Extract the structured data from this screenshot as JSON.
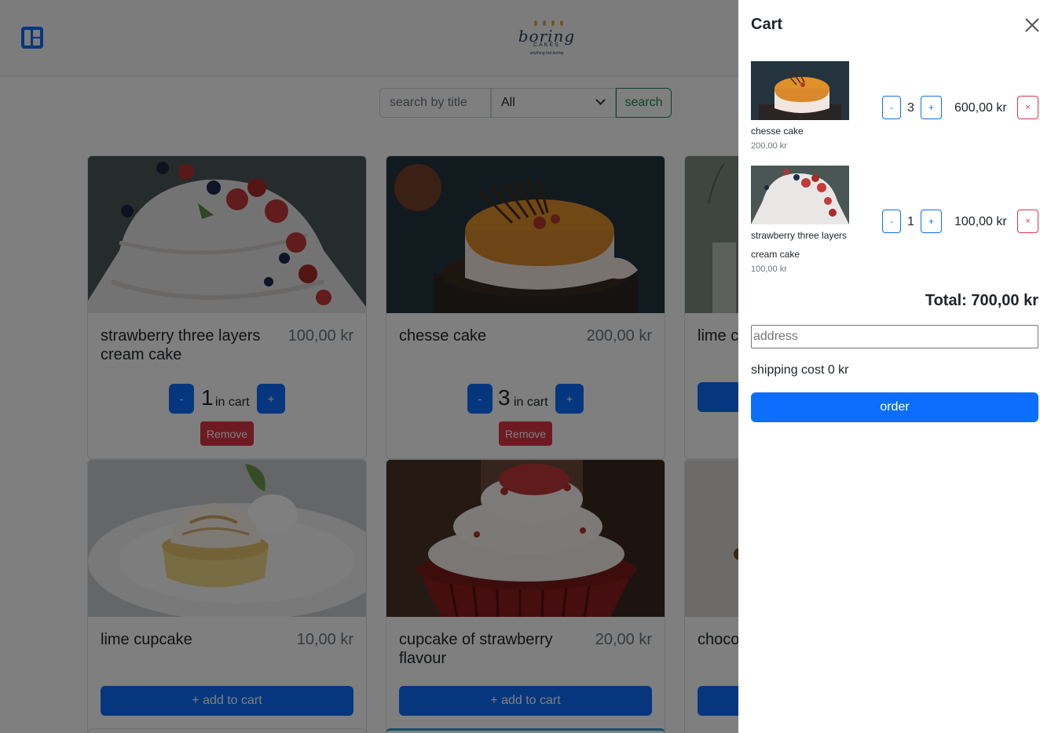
{
  "header": {
    "logo_text": "boring",
    "logo_sub": "CAKES",
    "logo_tagline": "anything but boring"
  },
  "search": {
    "placeholder": "search by title",
    "category_selected": "All",
    "button_label": "search"
  },
  "products": [
    {
      "title": "strawberry three layers cream cake",
      "price": "100,00 kr",
      "quantity": "1",
      "in_cart_label": "in cart",
      "minus_label": "-",
      "plus_label": "+",
      "remove_label": "Remove"
    },
    {
      "title": "chesse cake",
      "price": "200,00 kr",
      "quantity": "3",
      "in_cart_label": "in cart",
      "minus_label": "-",
      "plus_label": "+",
      "remove_label": "Remove"
    },
    {
      "title": "lime c"
    },
    {
      "title": "lime cupcake",
      "price": "10,00 kr",
      "add_label": "+ add to cart"
    },
    {
      "title": "cupcake of strawberry flavour",
      "price": "20,00 kr",
      "add_label": "+ add to cart"
    },
    {
      "title": "choco mint c"
    }
  ],
  "cart": {
    "title": "Cart",
    "items": [
      {
        "name": "chesse cake",
        "unit_price": "200,00 kr",
        "quantity": "3",
        "total": "600,00 kr",
        "minus_label": "-",
        "plus_label": "+",
        "remove_label": "×"
      },
      {
        "name": "strawberry three layers cream cake",
        "unit_price": "100,00 kr",
        "quantity": "1",
        "total": "100,00 kr",
        "minus_label": "-",
        "plus_label": "+",
        "remove_label": "×"
      }
    ],
    "total_label": "Total: 700,00 kr",
    "address_placeholder": "address",
    "shipping_label": "shipping cost 0 kr",
    "order_label": "order"
  },
  "colors": {
    "primary": "#0d6efd",
    "danger": "#dc3545",
    "success": "#198754"
  }
}
